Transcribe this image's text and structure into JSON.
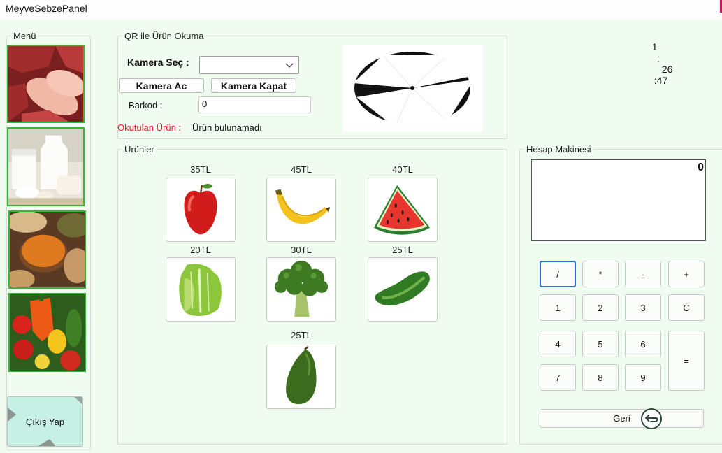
{
  "window": {
    "title": "MeyveSebzePanel"
  },
  "clock": {
    "hour": "1",
    "sep1": ":",
    "minute": "26",
    "sep2": ":",
    "second": "47"
  },
  "menu": {
    "legend": "Menü",
    "items": [
      {
        "name": "meat"
      },
      {
        "name": "dairy"
      },
      {
        "name": "legumes"
      },
      {
        "name": "vegetables"
      }
    ],
    "exit_label": "Çıkış Yap"
  },
  "qr": {
    "legend": "QR ile Ürün Okuma",
    "camera_select_label": "Kamera Seç :",
    "camera_select_value": "",
    "open_camera_label": "Kamera Ac",
    "close_camera_label": "Kamera Kapat",
    "barcode_label": "Barkod :",
    "barcode_value": "0",
    "scanned_label": "Okutulan Ürün :",
    "scanned_value": "Ürün bulunamadı",
    "scanned_label_color": "#e5202a"
  },
  "products": {
    "legend": "Ürünler",
    "items": [
      {
        "name": "apple",
        "price": "35TL"
      },
      {
        "name": "banana",
        "price": "45TL"
      },
      {
        "name": "watermelon",
        "price": "40TL"
      },
      {
        "name": "lettuce",
        "price": "20TL"
      },
      {
        "name": "broccoli",
        "price": "30TL"
      },
      {
        "name": "cucumber",
        "price": "25TL"
      },
      {
        "name": "avocado",
        "price": "25TL"
      }
    ]
  },
  "calculator": {
    "legend": "Hesap Makinesi",
    "display": "0",
    "keys": {
      "div": "/",
      "mul": "*",
      "sub": "-",
      "add": "+",
      "k1": "1",
      "k2": "2",
      "k3": "3",
      "clear": "C",
      "k4": "4",
      "k5": "5",
      "k6": "6",
      "eq": "=",
      "k7": "7",
      "k8": "8",
      "k9": "9"
    },
    "back_label": "Geri"
  }
}
